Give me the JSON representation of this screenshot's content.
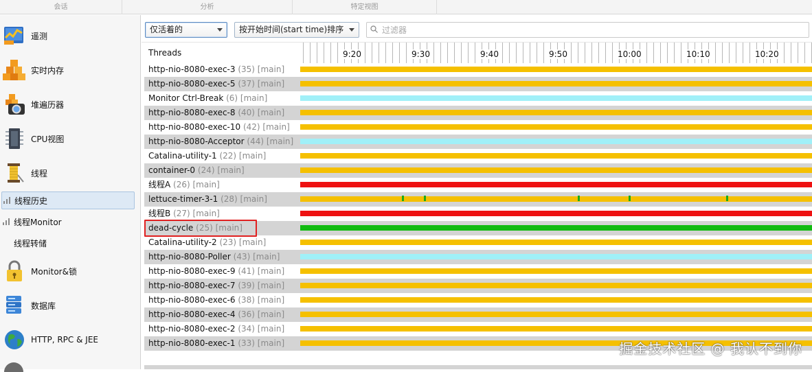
{
  "sections": [
    "会话",
    "分析",
    "特定视图"
  ],
  "sidebar": {
    "items": [
      {
        "label": "遥测",
        "icon": "telemetry-icon"
      },
      {
        "label": "实时内存",
        "icon": "live-memory-icon"
      },
      {
        "label": "堆遍历器",
        "icon": "heap-walker-icon"
      },
      {
        "label": "CPU视图",
        "icon": "cpu-views-icon"
      },
      {
        "label": "线程",
        "icon": "threads-icon"
      }
    ],
    "subitems": [
      {
        "label": "线程历史",
        "active": true
      },
      {
        "label": "线程Monitor",
        "active": false
      },
      {
        "label": "线程转储",
        "active": false
      }
    ],
    "items2": [
      {
        "label": "Monitor&锁",
        "icon": "lock-icon"
      },
      {
        "label": "数据库",
        "icon": "database-icon"
      },
      {
        "label": "HTTP, RPC & JEE",
        "icon": "globe-icon"
      }
    ]
  },
  "toolbar": {
    "filter_select": "仅活着的",
    "sort_select": "按开始时间(start time)排序",
    "filter_placeholder": "过滤器"
  },
  "table": {
    "header": "Threads",
    "timeline_labels": [
      "9:20",
      "9:30",
      "9:40",
      "9:50",
      "10:00",
      "10:10",
      "10:20"
    ],
    "rows": [
      {
        "name": "http-nio-8080-exec-3",
        "meta": "(35) [main]",
        "state": "waiting"
      },
      {
        "name": "http-nio-8080-exec-5",
        "meta": "(37) [main]",
        "state": "waiting"
      },
      {
        "name": "Monitor Ctrl-Break",
        "meta": "(6) [main]",
        "state": "net"
      },
      {
        "name": "http-nio-8080-exec-8",
        "meta": "(40) [main]",
        "state": "waiting"
      },
      {
        "name": "http-nio-8080-exec-10",
        "meta": "(42) [main]",
        "state": "waiting"
      },
      {
        "name": "http-nio-8080-Acceptor",
        "meta": "(44) [main]",
        "state": "net"
      },
      {
        "name": "Catalina-utility-1",
        "meta": "(22) [main]",
        "state": "waiting"
      },
      {
        "name": "container-0",
        "meta": "(24) [main]",
        "state": "waiting"
      },
      {
        "name": "线程A",
        "meta": "(26) [main]",
        "state": "blocked"
      },
      {
        "name": "lettuce-timer-3-1",
        "meta": "(28) [main]",
        "state": "waiting",
        "marks": [
          0.199,
          0.242,
          0.542,
          0.641,
          0.832
        ]
      },
      {
        "name": "线程B",
        "meta": "(27) [main]",
        "state": "blocked"
      },
      {
        "name": "dead-cycle",
        "meta": "(25) [main]",
        "state": "runnable",
        "highlighted": true
      },
      {
        "name": "Catalina-utility-2",
        "meta": "(23) [main]",
        "state": "waiting"
      },
      {
        "name": "http-nio-8080-Poller",
        "meta": "(43) [main]",
        "state": "net"
      },
      {
        "name": "http-nio-8080-exec-9",
        "meta": "(41) [main]",
        "state": "waiting"
      },
      {
        "name": "http-nio-8080-exec-7",
        "meta": "(39) [main]",
        "state": "waiting"
      },
      {
        "name": "http-nio-8080-exec-6",
        "meta": "(38) [main]",
        "state": "waiting"
      },
      {
        "name": "http-nio-8080-exec-4",
        "meta": "(36) [main]",
        "state": "waiting"
      },
      {
        "name": "http-nio-8080-exec-2",
        "meta": "(34) [main]",
        "state": "waiting"
      },
      {
        "name": "http-nio-8080-exec-1",
        "meta": "(33) [main]",
        "state": "waiting"
      }
    ]
  },
  "state_colors": {
    "waiting": "#f5c000",
    "net": "#a0f0f8",
    "blocked": "#ee1111",
    "runnable": "#11bb11"
  },
  "watermark": "掘金技术社区 @ 我认不到你"
}
